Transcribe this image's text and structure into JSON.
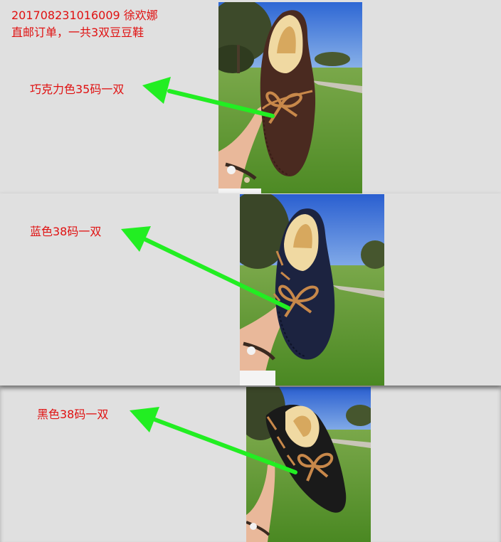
{
  "header": {
    "order_line": "201708231016009   徐欢娜",
    "note_line": "直邮订单，一共3双豆豆鞋"
  },
  "items": [
    {
      "label": "巧克力色35码一双",
      "shoe_color": "#4a2a20"
    },
    {
      "label": "蓝色38码一双",
      "shoe_color": "#1c2340"
    },
    {
      "label": "黑色38码一双",
      "shoe_color": "#1a1a1a"
    }
  ],
  "colors": {
    "label_text": "#e01010",
    "arrow": "#22ee22",
    "background": "#e0e0e0",
    "sky": "#2f6fd8",
    "grass": "#5e9a2c",
    "fur": "#f0d9a2",
    "lace": "#c8884a"
  }
}
